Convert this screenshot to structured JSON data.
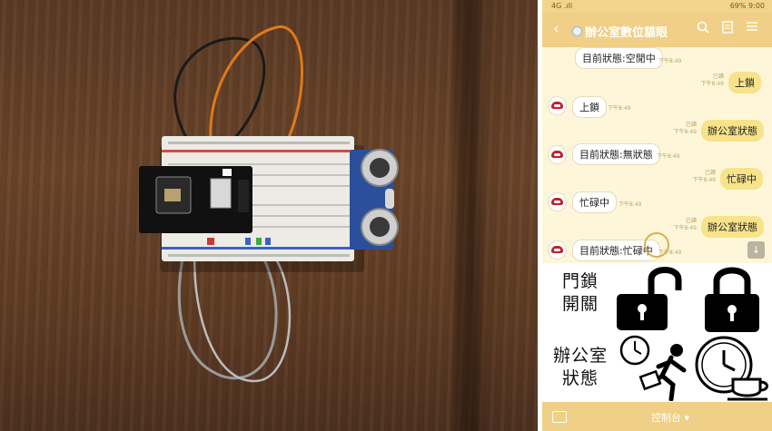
{
  "photo": {
    "description_icon": "esp32-cam-breadboard-ultrasonic-sensor"
  },
  "status_bar": {
    "left": "4G .ıll",
    "right": "69% 9:00"
  },
  "header": {
    "back_icon": "chevron-left-icon",
    "title": "辦公室數位貓眼",
    "icons": [
      "search-icon",
      "note-icon",
      "menu-icon"
    ]
  },
  "chat": {
    "messages": [
      {
        "dir": "in",
        "text": "目前狀態:空閒中",
        "time": "下午8:49"
      },
      {
        "dir": "out",
        "text": "上鎖",
        "read": "已讀",
        "time": "下午8:49"
      },
      {
        "dir": "in",
        "text": "上鎖",
        "time": "下午8:49"
      },
      {
        "dir": "out",
        "text": "辦公室狀態",
        "read": "已讀",
        "time": "下午8:49"
      },
      {
        "dir": "in",
        "text": "目前狀態:無狀態",
        "time": "下午8:49"
      },
      {
        "dir": "out",
        "text": "忙碌中",
        "read": "已讀",
        "time": "下午8:49"
      },
      {
        "dir": "in",
        "text": "忙碌中",
        "time": "下午8:49"
      },
      {
        "dir": "out",
        "text": "辦公室狀態",
        "read": "已讀",
        "time": "下午8:49"
      },
      {
        "dir": "in",
        "text": "目前狀態:忙碌中",
        "time": "下午8:49"
      }
    ]
  },
  "rich_menu": {
    "door_label_1": "門鎖",
    "door_label_2": "開關",
    "office_label_1": "辦公室",
    "office_label_2": "狀態",
    "unlock_icon": "unlocked-padlock-icon",
    "lock_icon": "locked-padlock-icon",
    "busy_icon": "running-with-briefcase-icon",
    "free_icon": "clock-and-coffee-icon"
  },
  "bottom_bar": {
    "control_label": "控制台 ▾"
  },
  "colors": {
    "accent": "#f0cf86",
    "chat_bg": "#fdf6d8",
    "out_bubble": "#f7e48a"
  }
}
